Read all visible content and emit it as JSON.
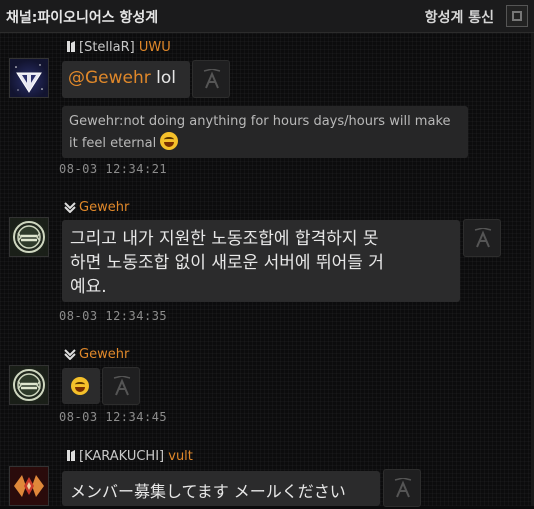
{
  "header": {
    "title": "채널:파이오니어스 항성계",
    "right_label": "항성계 통신"
  },
  "messages": [
    {
      "guild": "[StellaR]",
      "user": "UWU",
      "mention": "@Gewehr",
      "text": "lol",
      "quote": "Gewehr:not doing anything for hours days/hours will make it feel eternal",
      "time": "08-03 12:34:21"
    },
    {
      "user": "Gewehr",
      "text": "그리고 내가 지원한 노동조합에 합격하지 못하면 노동조합 없이 새로운 서버에 뛰어들 거예요.",
      "line1": "그리고 내가 지원한 노동조합에 합격하지 못",
      "line2": "하면 노동조합 없이 새로운 서버에 뛰어들 거",
      "line3": "예요.",
      "time": "08-03 12:34:35"
    },
    {
      "user": "Gewehr",
      "time": "08-03 12:34:45"
    },
    {
      "guild": "[KARAKUCHI]",
      "user": "vult",
      "text": "メンバー募集してます メールください"
    }
  ],
  "icons": {
    "rank": "knight-rank-icon",
    "down": "down-arrow-rank-icon",
    "react": "reaction-a-icon"
  },
  "colors": {
    "username": "#e0882a",
    "bubble": "#2b2b2c"
  }
}
